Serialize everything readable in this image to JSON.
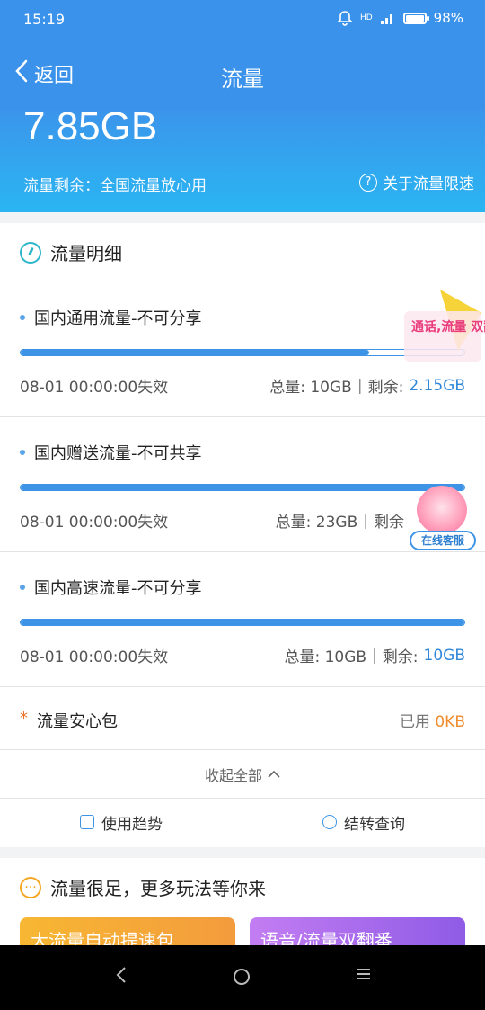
{
  "status_bar": {
    "time": "15:19",
    "network": "4G",
    "hd": "HD",
    "battery": "98%"
  },
  "header": {
    "back_label": "返回",
    "title": "流量"
  },
  "hero": {
    "total": "7.85GB",
    "remaining_label": "流量剩余：全国流量放心用",
    "limit_link": "关于流量限速"
  },
  "detail": {
    "title": "流量明细",
    "items": [
      {
        "name": "国内通用流量-不可分享",
        "expire": "08-01 00:00:00失效",
        "total": "总量: 10GB",
        "remaining_label": "剩余:",
        "remaining": "2.15GB",
        "fill": 0.785
      },
      {
        "name": "国内赠送流量-不可共享",
        "expire": "08-01 00:00:00失效",
        "total": "总量: 23GB",
        "remaining_label": "剩余",
        "remaining": "",
        "fill": 1.0
      },
      {
        "name": "国内高速流量-不可分享",
        "expire": "08-01 00:00:00失效",
        "total": "总量: 10GB",
        "remaining_label": "剩余:",
        "remaining": "10GB",
        "fill": 1.0
      }
    ],
    "safety": {
      "label": "流量安心包",
      "used_label": "已用",
      "used_value": "0KB"
    },
    "collapse_label": "收起全部",
    "actions": {
      "trend": "使用趋势",
      "transfer": "结转查询"
    }
  },
  "promo": {
    "title": "流量很足，更多玩法等你来",
    "card_a": "大流量自动提速包",
    "card_b": "语音/流量双翻番"
  },
  "floating": {
    "badge_text": "通话,流量 双翻番",
    "service_label": "在线客服"
  },
  "colors": {
    "primary": "#3a92ea",
    "accent_blue": "#3087d9",
    "accent_orange": "#f08b2c"
  }
}
